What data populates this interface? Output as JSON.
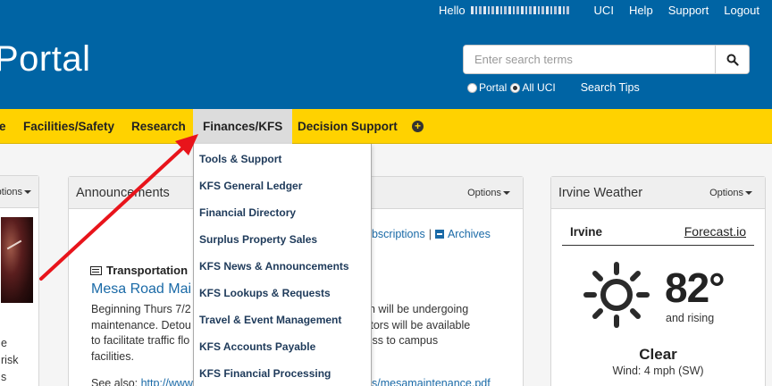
{
  "header": {
    "hello_label": "Hello",
    "links": [
      "UCI",
      "Help",
      "Support",
      "Logout"
    ],
    "brand": "Portal"
  },
  "search": {
    "placeholder": "Enter search terms",
    "scope_options": [
      "Portal",
      "All UCI"
    ],
    "selected_scope": "All UCI",
    "tips_label": "Search Tips"
  },
  "nav": {
    "items": [
      "e",
      "Facilities/Safety",
      "Research",
      "Finances/KFS",
      "Decision Support"
    ],
    "active": "Finances/KFS"
  },
  "dropdown": {
    "items": [
      "Tools & Support",
      "KFS General Ledger",
      "Financial Directory",
      "Surplus Property Sales",
      "KFS News & Announcements",
      "KFS Lookups & Requests",
      "Travel & Event Management",
      "KFS Accounts Payable",
      "KFS Financial Processing"
    ]
  },
  "left_panel": {
    "options_label": "ptions",
    "text_lines": [
      "e",
      "risk",
      "s"
    ]
  },
  "announcements": {
    "title": "Announcements",
    "options_label": "Options",
    "subscriptions_label": "ubscriptions",
    "separator": "|",
    "archives_label": "Archives",
    "category": "Transportation",
    "headline": "Mesa Road Mai",
    "body_lines": [
      "Beginning Thurs 7/2",
      "maintenance. Detou",
      "to facilitate traffic flo",
      "facilities."
    ],
    "body_right_lines": [
      "hich will be undergoing",
      "rectors will be available",
      "ccess to campus"
    ],
    "see_also_label": "See also:",
    "see_also_link": "http://www",
    "see_also_link_end": "s/mesamaintenance.pdf"
  },
  "weather": {
    "title": "Irvine Weather",
    "options_label": "Options",
    "location": "Irvine",
    "provider": "Forecast.io",
    "temperature": "82°",
    "trend": "and rising",
    "condition": "Clear",
    "wind": "Wind: 4 mph (SW)",
    "icon": "sun-icon"
  },
  "colors": {
    "header_blue": "#0064a4",
    "nav_gold": "#ffd200",
    "link_blue": "#1a6aa7",
    "annotation_red": "#e8141b"
  }
}
